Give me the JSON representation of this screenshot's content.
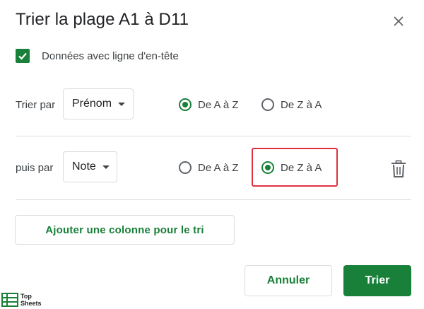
{
  "dialog": {
    "title": "Trier la plage A1 à D11",
    "close_icon": "close-icon"
  },
  "header_option": {
    "checked": true,
    "label": "Données avec ligne d'en-tête"
  },
  "sort_rows": [
    {
      "label": "Trier par",
      "column": "Prénom",
      "order_options": [
        "De A à Z",
        "De Z à A"
      ],
      "selected_order": "De A à Z"
    },
    {
      "label": "puis par",
      "column": "Note",
      "order_options": [
        "De A à Z",
        "De Z à A"
      ],
      "selected_order": "De Z à A",
      "delete_icon": "trash-icon"
    }
  ],
  "add_column_button": "Ajouter une colonne pour le tri",
  "buttons": {
    "cancel": "Annuler",
    "sort": "Trier"
  },
  "watermark": {
    "line1": "Top",
    "line2": "Sheets"
  },
  "colors": {
    "accent": "#188038",
    "highlight": "#e0303f",
    "border": "#dadce0"
  }
}
